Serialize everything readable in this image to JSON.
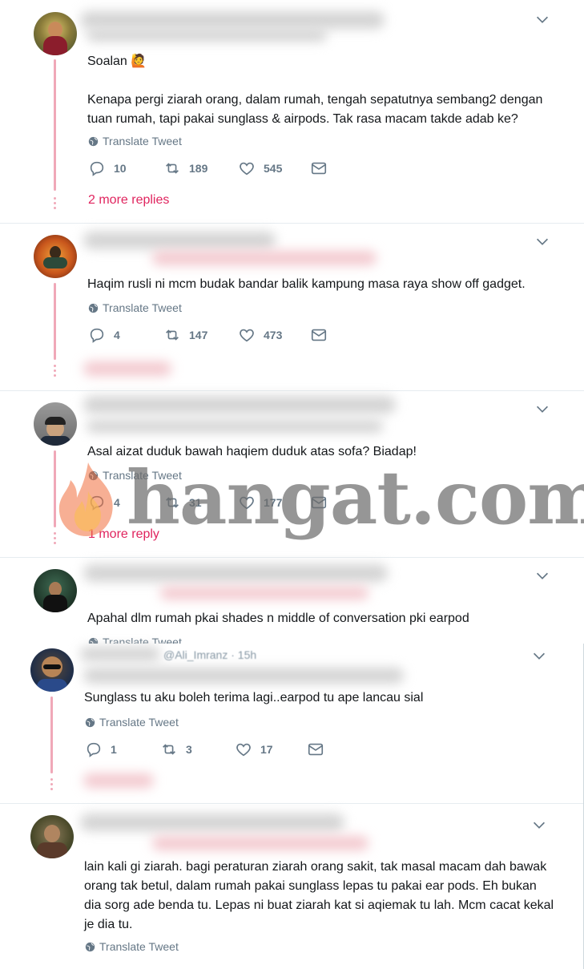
{
  "tweets": [
    {
      "text": "Soalan 🙋\n\nKenapa pergi ziarah orang, dalam rumah, tengah sepatutnya sembang2 dengan tuan rumah, tapi pakai sunglass & airpods. Tak rasa macam takde adab ke?",
      "translate": "Translate Tweet",
      "replies": "10",
      "retweets": "189",
      "likes": "545",
      "more_replies": "2 more replies"
    },
    {
      "text": "Haqim rusli ni mcm budak bandar balik kampung masa raya show off gadget.",
      "translate": "Translate Tweet",
      "replies": "4",
      "retweets": "147",
      "likes": "473"
    },
    {
      "text": "Asal aizat duduk bawah haqiem duduk atas sofa? Biadap!",
      "translate": "Translate Tweet",
      "replies": "4",
      "retweets": "31",
      "likes": "177",
      "more_replies": "1 more reply"
    },
    {
      "text": "Apahal dlm rumah pkai shades n middle of conversation pki earpod",
      "translate": "Translate Tweet"
    },
    {
      "header_partial": "@Ali_Imranz · 15h",
      "text": "Sunglass tu aku boleh terima lagi..earpod tu ape lancau sial",
      "translate": "Translate Tweet",
      "replies": "1",
      "retweets": "3",
      "likes": "17"
    },
    {
      "text": "lain kali gi ziarah. bagi peraturan ziarah orang sakit, tak masal macam dah bawak orang tak betul, dalam rumah pakai sunglass lepas tu pakai ear pods. Eh bukan dia sorg ade benda tu. Lepas ni buat ziarah kat si aqiemak tu lah. Mcm cacat kekal je dia tu.",
      "translate": "Translate Tweet"
    }
  ],
  "watermark": "hangat.com",
  "colors": {
    "text": "#14171a",
    "muted": "#657786",
    "accent_red": "#e0245e",
    "thread_line": "#f0a8b8",
    "divider": "#e6ecf0"
  },
  "icons": [
    "reply-icon",
    "retweet-icon",
    "like-icon",
    "dm-icon",
    "globe-icon",
    "chevron-down-icon",
    "flame-icon"
  ]
}
